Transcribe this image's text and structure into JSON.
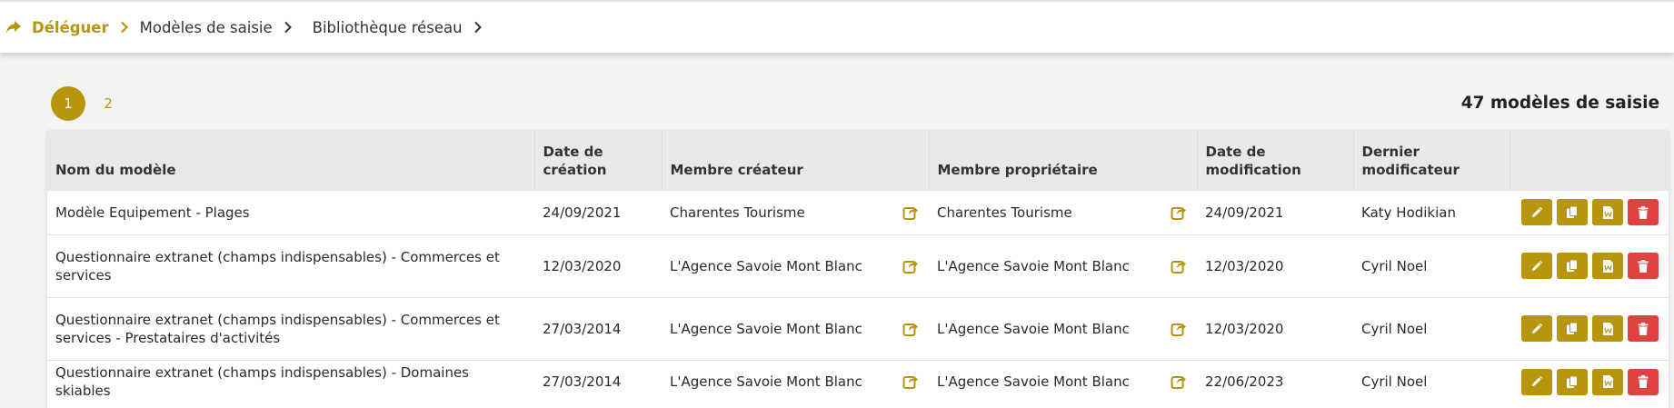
{
  "colors": {
    "accent": "#b8960c",
    "danger": "#e04242",
    "header_bg": "#e9e9e9"
  },
  "breadcrumb": {
    "icon": "share-arrow-icon",
    "items": [
      "Déléguer",
      "Modèles de saisie",
      "Bibliothèque réseau"
    ]
  },
  "pagination": {
    "pages": [
      "1",
      "2"
    ],
    "current": "1"
  },
  "count_label": "47 modèles de saisie",
  "table": {
    "headers": {
      "name": "Nom du modèle",
      "created_l1": "Date de",
      "created_l2": "création",
      "creator": "Membre créateur",
      "owner": "Membre propriétaire",
      "modified_l1": "Date de",
      "modified_l2": "modification",
      "modifier_l1": "Dernier",
      "modifier_l2": "modificateur"
    },
    "rows": [
      {
        "name": "Modèle Equipement - Plages",
        "created": "24/09/2021",
        "creator": "Charentes Tourisme",
        "owner": "Charentes Tourisme",
        "modified": "24/09/2021",
        "modifier": "Katy Hodikian"
      },
      {
        "name": "Questionnaire extranet (champs indispensables) - Commerces et services",
        "created": "12/03/2020",
        "creator": "L'Agence Savoie Mont Blanc",
        "owner": "L'Agence Savoie Mont Blanc",
        "modified": "12/03/2020",
        "modifier": "Cyril Noel"
      },
      {
        "name": "Questionnaire extranet (champs indispensables) - Commerces et services - Prestataires d'activités",
        "created": "27/03/2014",
        "creator": "L'Agence Savoie Mont Blanc",
        "owner": "L'Agence Savoie Mont Blanc",
        "modified": "12/03/2020",
        "modifier": "Cyril Noel"
      },
      {
        "name": "Questionnaire extranet (champs indispensables) - Domaines skiables",
        "created": "27/03/2014",
        "creator": "L'Agence Savoie Mont Blanc",
        "owner": "L'Agence Savoie Mont Blanc",
        "modified": "22/06/2023",
        "modifier": "Cyril Noel"
      }
    ],
    "row_actions": [
      "pencil-icon",
      "copy-icon",
      "word-doc-icon",
      "trash-icon"
    ]
  }
}
